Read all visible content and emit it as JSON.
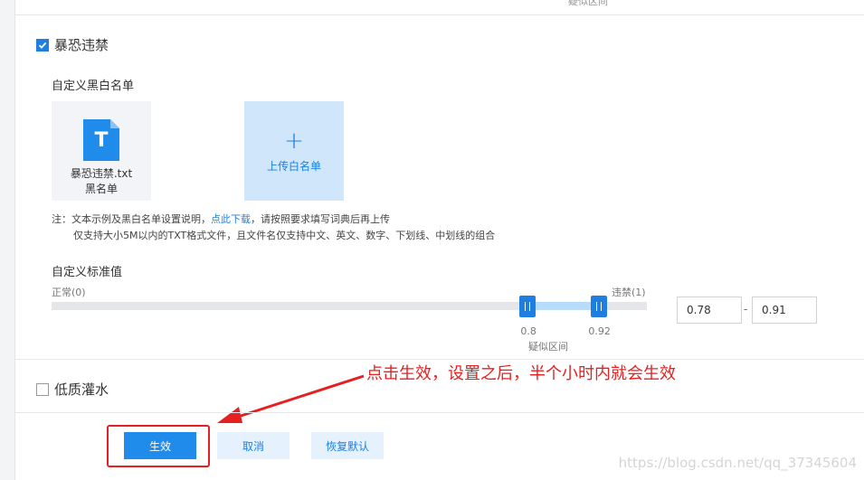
{
  "top_cut_text": "疑似区间",
  "section_terror": {
    "title": "暴恐违禁",
    "checked": true
  },
  "blacklist": {
    "heading": "自定义黑白名单",
    "file": {
      "icon_letter": "T",
      "icon": "txt-file-icon",
      "filename": "暴恐违禁.txt",
      "list_type": "黑名单"
    },
    "upload": {
      "plus": "+",
      "label": "上传白名单"
    },
    "note": {
      "prefix": "注：文本示例及黑白名单设置说明，",
      "link": "点此下载",
      "suffix": "，请按照要求填写词典后再上传",
      "line2": "仅支持大小5M以内的TXT格式文件，且文件名仅支持中文、英文、数字、下划线、中划线的组合"
    }
  },
  "threshold": {
    "heading": "自定义标准值",
    "left_label": "正常(0)",
    "right_label": "违禁(1)",
    "low": 0.8,
    "high": 0.92,
    "low_label": "0.8",
    "high_label": "0.92",
    "range_label": "疑似区间",
    "input_low": "0.78",
    "input_high": "0.91",
    "dash": "-"
  },
  "section_lowquality": {
    "title": "低质灌水",
    "checked": false
  },
  "annotation": "点击生效，设置之后，半个小时内就会生效",
  "buttons": {
    "apply": "生效",
    "cancel": "取消",
    "reset": "恢复默认"
  },
  "watermark": "https://blog.csdn.net/qq_37345604",
  "colors": {
    "primary": "#1f8ceb",
    "annotation": "#e62020"
  }
}
